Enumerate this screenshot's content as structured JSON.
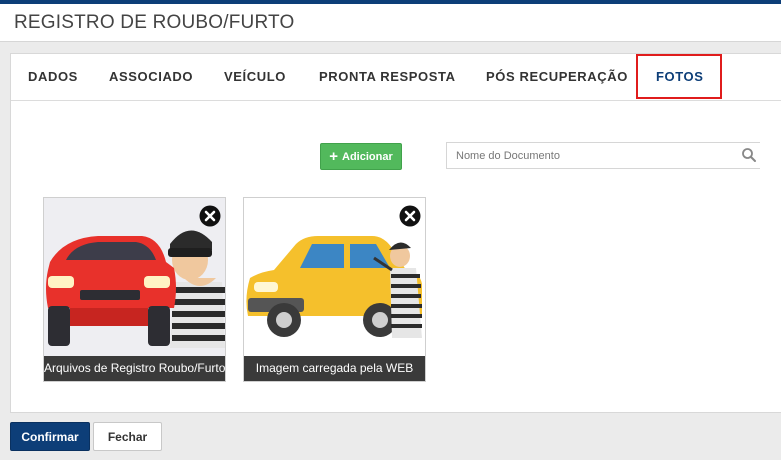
{
  "page": {
    "title": "REGISTRO DE ROUBO/FURTO"
  },
  "tabs": [
    {
      "label": "DADOS"
    },
    {
      "label": "ASSOCIADO"
    },
    {
      "label": "VEÍCULO"
    },
    {
      "label": "PRONTA RESPOSTA"
    },
    {
      "label": "PÓS RECUPERAÇÃO"
    },
    {
      "label": "FOTOS",
      "active": true
    }
  ],
  "toolbar": {
    "add_label": "Adicionar",
    "search_placeholder": "Nome do Documento"
  },
  "photos": [
    {
      "caption": "Arquivos de Registro Roubo/Furto",
      "car_color": "#e8312b",
      "icon": "red-car-thief-image"
    },
    {
      "caption": "Imagem carregada pela WEB",
      "car_color": "#f5c02c",
      "icon": "yellow-car-thief-image"
    }
  ],
  "footer": {
    "confirm_label": "Confirmar",
    "close_label": "Fechar"
  },
  "colors": {
    "brand": "#0d3e78",
    "add_button": "#52b95c",
    "highlight": "#e01c1c"
  }
}
